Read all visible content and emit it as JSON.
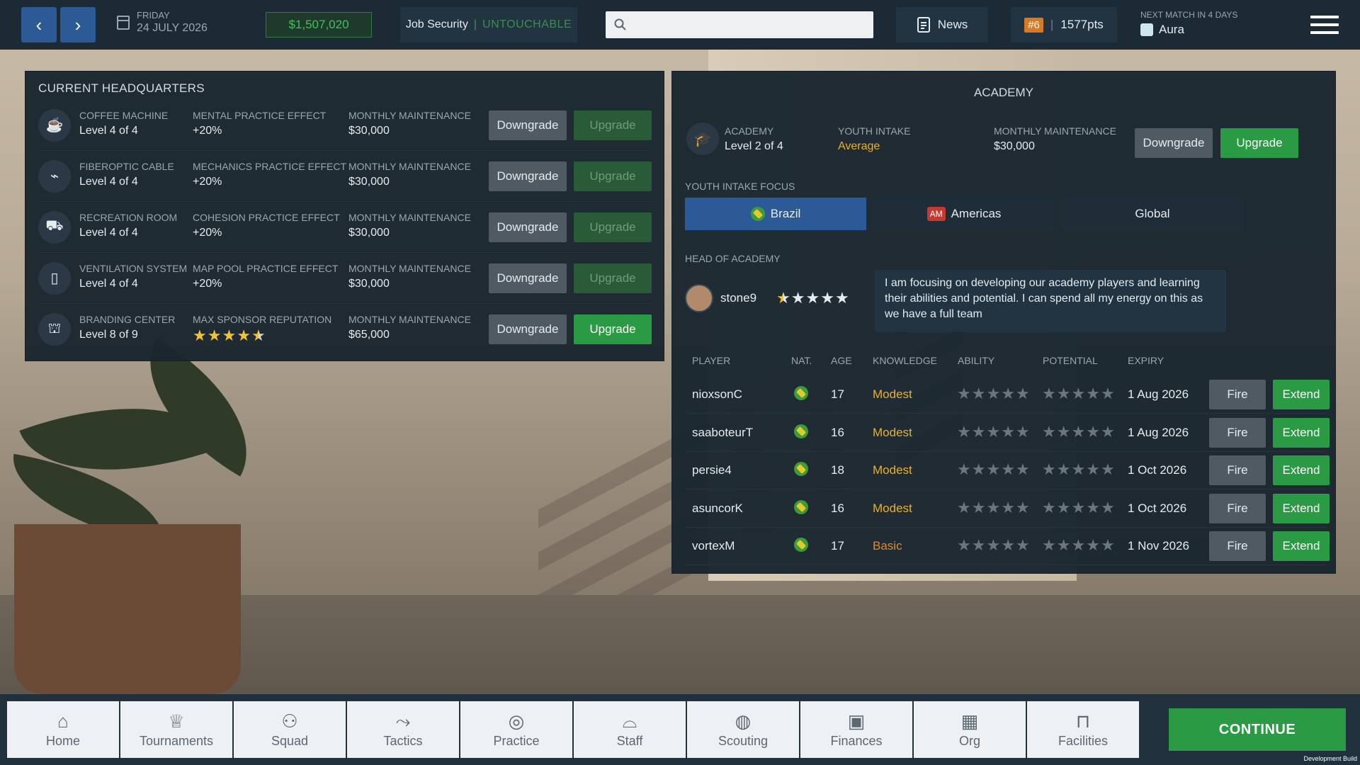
{
  "topbar": {
    "back": "‹",
    "forward": "›",
    "weekday": "FRIDAY",
    "date": "24 JULY 2026",
    "balance": "$1,507,020",
    "job_security_label": "Job Security",
    "job_security_value": "UNTOUCHABLE",
    "search_placeholder": "",
    "news": "News",
    "rank": "#6",
    "points": "1577pts",
    "next_match_label": "NEXT MATCH IN 4 DAYS",
    "next_opponent": "Aura"
  },
  "hq": {
    "title": "CURRENT HEADQUARTERS",
    "rows": [
      {
        "name": "COFFEE MACHINE",
        "level": "Level 4 of 4",
        "effect_label": "MENTAL PRACTICE EFFECT",
        "effect_value": "+20%",
        "maint_label": "MONTHLY MAINTENANCE",
        "maint_value": "$30,000",
        "downgrade": "Downgrade",
        "upgrade": "Upgrade",
        "icon": "coffee-machine-icon"
      },
      {
        "name": "FIBEROPTIC CABLE",
        "level": "Level 4 of 4",
        "effect_label": "MECHANICS PRACTICE EFFECT",
        "effect_value": "+20%",
        "maint_label": "MONTHLY MAINTENANCE",
        "maint_value": "$30,000",
        "downgrade": "Downgrade",
        "upgrade": "Upgrade",
        "icon": "cable-icon"
      },
      {
        "name": "RECREATION ROOM",
        "level": "Level 4 of 4",
        "effect_label": "COHESION PRACTICE EFFECT",
        "effect_value": "+20%",
        "maint_label": "MONTHLY MAINTENANCE",
        "maint_value": "$30,000",
        "downgrade": "Downgrade",
        "upgrade": "Upgrade",
        "icon": "recreation-icon"
      },
      {
        "name": "VENTILATION SYSTEM",
        "level": "Level 4 of 4",
        "effect_label": "MAP POOL PRACTICE EFFECT",
        "effect_value": "+20%",
        "maint_label": "MONTHLY MAINTENANCE",
        "maint_value": "$30,000",
        "downgrade": "Downgrade",
        "upgrade": "Upgrade",
        "icon": "ventilation-icon"
      },
      {
        "name": "BRANDING CENTER",
        "level": "Level 8 of 9",
        "effect_label": "MAX SPONSOR REPUTATION",
        "effect_value": "",
        "maint_label": "MONTHLY MAINTENANCE",
        "maint_value": "$65,000",
        "downgrade": "Downgrade",
        "upgrade": "Upgrade",
        "icon": "branding-icon",
        "stars": 4.5
      }
    ]
  },
  "academy": {
    "title": "ACADEMY",
    "academy_label": "ACADEMY",
    "academy_level": "Level 2 of 4",
    "intake_label": "YOUTH INTAKE",
    "intake_value": "Average",
    "maint_label": "MONTHLY MAINTENANCE",
    "maint_value": "$30,000",
    "downgrade": "Downgrade",
    "upgrade": "Upgrade",
    "focus_label": "YOUTH INTAKE FOCUS",
    "focus_options": [
      "Brazil",
      "Americas",
      "Global"
    ],
    "focus_am_badge": "AM",
    "head_label": "HEAD OF ACADEMY",
    "head_name": "stone9",
    "head_stars": 4.5,
    "head_quote": "I am focusing on developing our academy players and learning their abilities and potential. I can spend all my energy on this as we have a full team",
    "columns": [
      "PLAYER",
      "NAT.",
      "AGE",
      "KNOWLEDGE",
      "ABILITY",
      "POTENTIAL",
      "EXPIRY"
    ],
    "fire": "Fire",
    "extend": "Extend",
    "players": [
      {
        "name": "nioxsonC",
        "age": "17",
        "knowledge": "Modest",
        "expiry": "1 Aug 2026"
      },
      {
        "name": "saaboteurT",
        "age": "16",
        "knowledge": "Modest",
        "expiry": "1 Aug 2026"
      },
      {
        "name": "persie4",
        "age": "18",
        "knowledge": "Modest",
        "expiry": "1 Oct 2026"
      },
      {
        "name": "asuncorK",
        "age": "16",
        "knowledge": "Modest",
        "expiry": "1 Oct 2026"
      },
      {
        "name": "vortexM",
        "age": "17",
        "knowledge": "Basic",
        "expiry": "1 Nov 2026"
      }
    ]
  },
  "nav": {
    "tabs": [
      {
        "label": "Home",
        "icon": "home-icon",
        "glyph": "⌂"
      },
      {
        "label": "Tournaments",
        "icon": "trophy-icon",
        "glyph": "♕"
      },
      {
        "label": "Squad",
        "icon": "squad-icon",
        "glyph": "⚇"
      },
      {
        "label": "Tactics",
        "icon": "tactics-icon",
        "glyph": "⤳"
      },
      {
        "label": "Practice",
        "icon": "target-icon",
        "glyph": "◎"
      },
      {
        "label": "Staff",
        "icon": "whistle-icon",
        "glyph": "⌓"
      },
      {
        "label": "Scouting",
        "icon": "globe-search-icon",
        "glyph": "◍"
      },
      {
        "label": "Finances",
        "icon": "money-icon",
        "glyph": "▣"
      },
      {
        "label": "Org",
        "icon": "building-icon",
        "glyph": "▦"
      },
      {
        "label": "Facilities",
        "icon": "facilities-icon",
        "glyph": "⊓"
      }
    ],
    "continue": "CONTINUE"
  },
  "footer": {
    "dev_build": "Development Build"
  },
  "colors": {
    "accent_green": "#2a9a45",
    "primary_blue": "#2c5a96",
    "knowledge_modest": "#e5b230",
    "knowledge_basic": "#e08a2a",
    "star_yellow": "#f2c230"
  }
}
